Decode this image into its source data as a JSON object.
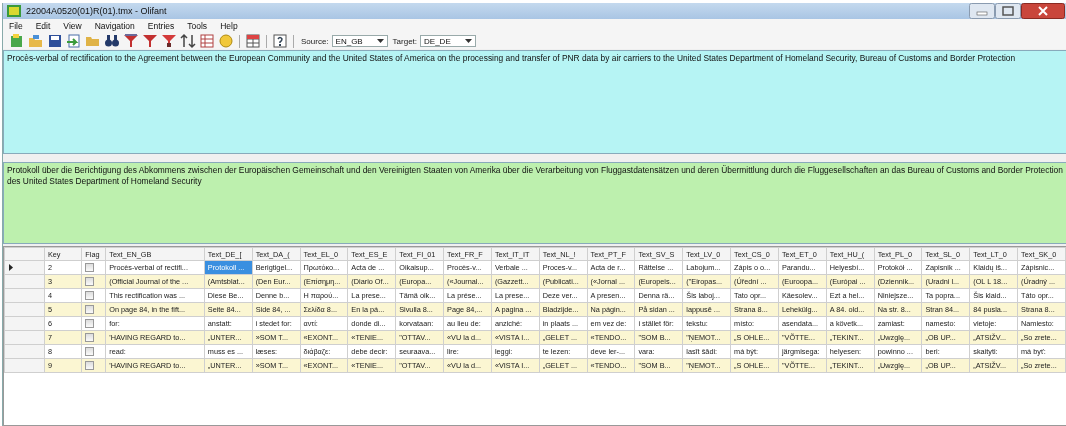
{
  "window": {
    "title": "22004A0520(01)R(01).tmx - Olifant"
  },
  "menu": [
    {
      "label": "File"
    },
    {
      "label": "Edit"
    },
    {
      "label": "View"
    },
    {
      "label": "Navigation"
    },
    {
      "label": "Entries"
    },
    {
      "label": "Tools"
    },
    {
      "label": "Help"
    }
  ],
  "toolbar": {
    "source_label": "Source:",
    "source": "EN_GB",
    "target_label": "Target:",
    "target": "DE_DE"
  },
  "source_text": "Procès-verbal of rectification to the Agreement between the European Community and the United States of America on the processing and transfer of PNR data by air carriers to the United States Department of Homeland Security, Bureau of Customs and Border Protection",
  "target_text": "Protokoll über die Berichtigung des Abkommens zwischen der Europäischen Gemeinschaft und den Vereinigten Staaten von Amerika über die Verarbeitung von Fluggastdatensätzen und deren Übermittlung durch die Fluggesellschaften an das Bureau of Customs and Border Protection des United States Department of Homeland Security",
  "table": {
    "key_header": "Key",
    "flag_header": "Flag",
    "columns": [
      "Text_EN_GB",
      "Text_DE_[",
      "Text_DA_(",
      "Text_EL_0",
      "Text_ES_E",
      "Text_FI_01",
      "Text_FR_F",
      "Text_IT_IT",
      "Text_NL_!",
      "Text_PT_F",
      "Text_SV_S",
      "Text_LV_0",
      "Text_CS_0",
      "Text_ET_0",
      "Text_HU_(",
      "Text_PL_0",
      "Text_SL_0",
      "Text_LT_0",
      "Text_SK_0"
    ],
    "rows": [
      {
        "key": "2",
        "current": true,
        "flag": false,
        "cells": [
          {
            "text": "Procès-verbal of rectifi...",
            "selected": false
          },
          {
            "text": "Protokoll ...",
            "selected": true
          },
          {
            "text": "Berigtigel...",
            "selected": false
          },
          {
            "text": "Πρωτόκο...",
            "selected": false
          },
          {
            "text": "Acta de ...",
            "selected": false
          },
          {
            "text": "Oikaisup...",
            "selected": false
          },
          {
            "text": "Procès-v...",
            "selected": false
          },
          {
            "text": "Verbale ...",
            "selected": false
          },
          {
            "text": "Proces-v...",
            "selected": false
          },
          {
            "text": "Acta de r...",
            "selected": false
          },
          {
            "text": "Rättelse ...",
            "selected": false
          },
          {
            "text": "Labojum...",
            "selected": false
          },
          {
            "text": "Zápis o o...",
            "selected": false
          },
          {
            "text": "Parandu...",
            "selected": false
          },
          {
            "text": "Helyesbí...",
            "selected": false
          },
          {
            "text": "Protokół ...",
            "selected": false
          },
          {
            "text": "Zapisnik ...",
            "selected": false
          },
          {
            "text": "Klaidų iš...",
            "selected": false
          },
          {
            "text": "Zápisnic...",
            "selected": false
          }
        ]
      },
      {
        "key": "3",
        "current": false,
        "flag": false,
        "cells": [
          {
            "text": "(Official Journal of the ...",
            "selected": false
          },
          {
            "text": "(Amtsblat...",
            "selected": false
          },
          {
            "text": "(Den Eur...",
            "selected": false
          },
          {
            "text": "(Επίσημη...",
            "selected": false
          },
          {
            "text": "(Diario Of...",
            "selected": false
          },
          {
            "text": "(Europa...",
            "selected": false
          },
          {
            "text": "(«Journal...",
            "selected": false
          },
          {
            "text": "(Gazzett...",
            "selected": false
          },
          {
            "text": "(Publicati...",
            "selected": false
          },
          {
            "text": "(«Jornal ...",
            "selected": false
          },
          {
            "text": "(Europeis...",
            "selected": false
          },
          {
            "text": "(\"Eiropas...",
            "selected": false
          },
          {
            "text": "(Úřední ...",
            "selected": false
          },
          {
            "text": "(Euroopa...",
            "selected": false
          },
          {
            "text": "(Európai ...",
            "selected": false
          },
          {
            "text": "(Dziennik...",
            "selected": false
          },
          {
            "text": "(Uradni l...",
            "selected": false
          },
          {
            "text": "(OL L 18...",
            "selected": false
          },
          {
            "text": "(Úradný ...",
            "selected": false
          }
        ]
      },
      {
        "key": "4",
        "current": false,
        "flag": false,
        "cells": [
          {
            "text": "This rectification was ...",
            "selected": false
          },
          {
            "text": "Diese Be...",
            "selected": false
          },
          {
            "text": "Denne b...",
            "selected": false
          },
          {
            "text": "Η παρού...",
            "selected": false
          },
          {
            "text": "La prese...",
            "selected": false
          },
          {
            "text": "Tämä oik...",
            "selected": false
          },
          {
            "text": "La prése...",
            "selected": false
          },
          {
            "text": "La prese...",
            "selected": false
          },
          {
            "text": "Deze ver...",
            "selected": false
          },
          {
            "text": "A presen...",
            "selected": false
          },
          {
            "text": "Denna rä...",
            "selected": false
          },
          {
            "text": "Šis laboj...",
            "selected": false
          },
          {
            "text": "Tato opr...",
            "selected": false
          },
          {
            "text": "Käesolev...",
            "selected": false
          },
          {
            "text": "Ezt a hel...",
            "selected": false
          },
          {
            "text": "Niniejsze...",
            "selected": false
          },
          {
            "text": "Ta popra...",
            "selected": false
          },
          {
            "text": "Šis klaid...",
            "selected": false
          },
          {
            "text": "Táto opr...",
            "selected": false
          }
        ]
      },
      {
        "key": "5",
        "current": false,
        "flag": false,
        "cells": [
          {
            "text": "On page 84, in the fift...",
            "selected": false
          },
          {
            "text": "Seite 84...",
            "selected": false
          },
          {
            "text": "Side 84, ...",
            "selected": false
          },
          {
            "text": "Σελίδα 8...",
            "selected": false
          },
          {
            "text": "En la pá...",
            "selected": false
          },
          {
            "text": "Sivulla 8...",
            "selected": false
          },
          {
            "text": "Page 84,...",
            "selected": false
          },
          {
            "text": "A pagina ...",
            "selected": false
          },
          {
            "text": "Bladzijde...",
            "selected": false
          },
          {
            "text": "Na págin...",
            "selected": false
          },
          {
            "text": "På sidan ...",
            "selected": false
          },
          {
            "text": "lappusē ...",
            "selected": false
          },
          {
            "text": "Strana 8...",
            "selected": false
          },
          {
            "text": "Lehekülg...",
            "selected": false
          },
          {
            "text": "A 84. old...",
            "selected": false
          },
          {
            "text": "Na str. 8...",
            "selected": false
          },
          {
            "text": "Stran 84...",
            "selected": false
          },
          {
            "text": "84 pusla...",
            "selected": false
          },
          {
            "text": "Strana 8...",
            "selected": false
          }
        ]
      },
      {
        "key": "6",
        "current": false,
        "flag": false,
        "cells": [
          {
            "text": "for:",
            "selected": false
          },
          {
            "text": "anstatt:",
            "selected": false
          },
          {
            "text": "i stedet for:",
            "selected": false
          },
          {
            "text": "αντί:",
            "selected": false
          },
          {
            "text": "donde di...",
            "selected": false
          },
          {
            "text": "korvataan:",
            "selected": false
          },
          {
            "text": "au lieu de:",
            "selected": false
          },
          {
            "text": "anziché:",
            "selected": false
          },
          {
            "text": "in plaats ...",
            "selected": false
          },
          {
            "text": "em vez de:",
            "selected": false
          },
          {
            "text": "i stället för:",
            "selected": false
          },
          {
            "text": "tekstu:",
            "selected": false
          },
          {
            "text": "místo:",
            "selected": false
          },
          {
            "text": "asendata...",
            "selected": false
          },
          {
            "text": "a követk...",
            "selected": false
          },
          {
            "text": "zamiast:",
            "selected": false
          },
          {
            "text": "namesto:",
            "selected": false
          },
          {
            "text": "vietoje:",
            "selected": false
          },
          {
            "text": "Namiesto:",
            "selected": false
          }
        ]
      },
      {
        "key": "7",
        "current": false,
        "flag": false,
        "cells": [
          {
            "text": "'HAVING REGARD to...",
            "selected": false
          },
          {
            "text": "„UNTER...",
            "selected": false
          },
          {
            "text": "»SOM T...",
            "selected": false
          },
          {
            "text": "«ΕΧΟΝΤ...",
            "selected": false
          },
          {
            "text": "«TENIE...",
            "selected": false
          },
          {
            "text": "\"OTTAV...",
            "selected": false
          },
          {
            "text": "«VU la d...",
            "selected": false
          },
          {
            "text": "«VISTA I...",
            "selected": false
          },
          {
            "text": "„GELET ...",
            "selected": false
          },
          {
            "text": "«TENDO...",
            "selected": false
          },
          {
            "text": "\"SOM B...",
            "selected": false
          },
          {
            "text": "\"ŅEMOT...",
            "selected": false
          },
          {
            "text": "„S OHLE...",
            "selected": false
          },
          {
            "text": "\"VÕTTE...",
            "selected": false
          },
          {
            "text": "„TEKINT...",
            "selected": false
          },
          {
            "text": "„Uwzglę...",
            "selected": false
          },
          {
            "text": "„OB UP...",
            "selected": false
          },
          {
            "text": "„ATSIŽV...",
            "selected": false
          },
          {
            "text": "„So zrete...",
            "selected": false
          }
        ]
      },
      {
        "key": "8",
        "current": false,
        "flag": false,
        "cells": [
          {
            "text": "read:",
            "selected": false
          },
          {
            "text": "muss es ...",
            "selected": false
          },
          {
            "text": "læses:",
            "selected": false
          },
          {
            "text": "διάβαζε:",
            "selected": false
          },
          {
            "text": "debe decir:",
            "selected": false
          },
          {
            "text": "seuraava...",
            "selected": false
          },
          {
            "text": "lire:",
            "selected": false
          },
          {
            "text": "leggi:",
            "selected": false
          },
          {
            "text": "te lezen:",
            "selected": false
          },
          {
            "text": "deve ler-...",
            "selected": false
          },
          {
            "text": "vara:",
            "selected": false
          },
          {
            "text": "lasīt šādi:",
            "selected": false
          },
          {
            "text": "má být:",
            "selected": false
          },
          {
            "text": "järgmisega:",
            "selected": false
          },
          {
            "text": "helyesen:",
            "selected": false
          },
          {
            "text": "powinno ...",
            "selected": false
          },
          {
            "text": "beri:",
            "selected": false
          },
          {
            "text": "skaityti:",
            "selected": false
          },
          {
            "text": "má byť:",
            "selected": false
          }
        ]
      },
      {
        "key": "9",
        "current": false,
        "flag": false,
        "cells": [
          {
            "text": "'HAVING REGARD to...",
            "selected": false
          },
          {
            "text": "„UNTER...",
            "selected": false
          },
          {
            "text": "»SOM T...",
            "selected": false
          },
          {
            "text": "«ΕΧΟΝΤ...",
            "selected": false
          },
          {
            "text": "«TENIE...",
            "selected": false
          },
          {
            "text": "\"OTTAV...",
            "selected": false
          },
          {
            "text": "«VU la d...",
            "selected": false
          },
          {
            "text": "«VISTA I...",
            "selected": false
          },
          {
            "text": "„GELET ...",
            "selected": false
          },
          {
            "text": "«TENDO...",
            "selected": false
          },
          {
            "text": "\"SOM B...",
            "selected": false
          },
          {
            "text": "\"ŅEMOT...",
            "selected": false
          },
          {
            "text": "„S OHLE...",
            "selected": false
          },
          {
            "text": "\"VÕTTE...",
            "selected": false
          },
          {
            "text": "„TEKINT...",
            "selected": false
          },
          {
            "text": "„Uwzglę...",
            "selected": false
          },
          {
            "text": "„OB UP...",
            "selected": false
          },
          {
            "text": "„ATSIŽV...",
            "selected": false
          },
          {
            "text": "„So zrete...",
            "selected": false
          }
        ]
      }
    ]
  }
}
